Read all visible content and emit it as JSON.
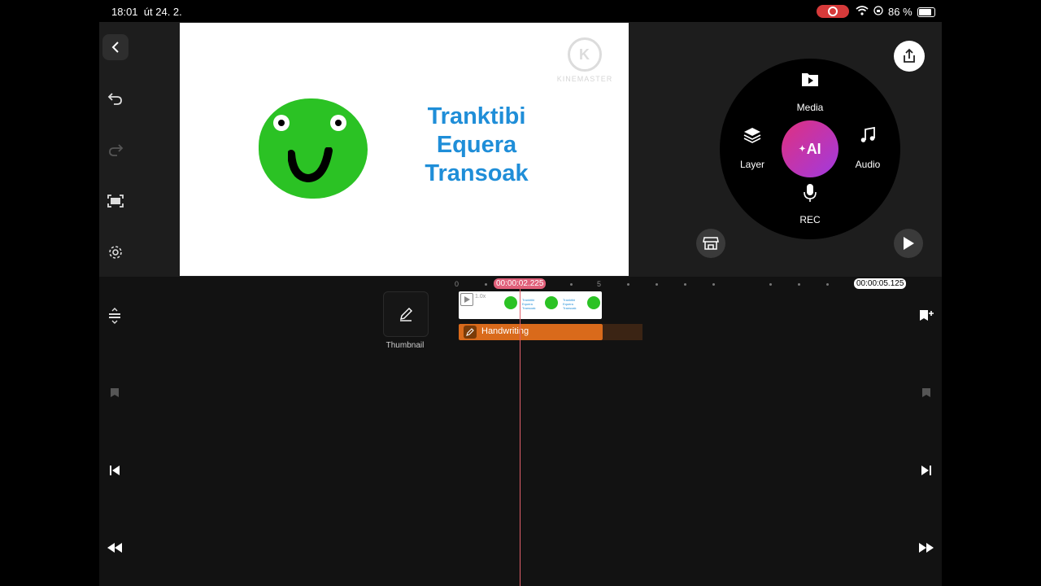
{
  "status_bar": {
    "time": "18:01",
    "date": "út 24. 2.",
    "battery": "86 %"
  },
  "preview": {
    "title_lines": [
      "Tranktibi",
      "Equera",
      "Transoak"
    ],
    "watermark": "KINEMASTER"
  },
  "media_wheel": {
    "media_label": "Media",
    "layer_label": "Layer",
    "audio_label": "Audio",
    "rec_label": "REC",
    "ai_label": "AI"
  },
  "timeline": {
    "current_time": "00:00:02.225",
    "total_time": "00:00:05.125",
    "ruler_marks": [
      "0",
      "5"
    ],
    "thumbnail_label": "Thumbnail",
    "layer_label": "Handwriting",
    "clip_speed": "1.0x",
    "clip_caption": [
      "Tranktibi",
      "Equera",
      "Transoak"
    ]
  },
  "colors": {
    "accent_ai_start": "#e0307f",
    "accent_ai_end": "#a03ae0",
    "layer_bar": "#d96a1b",
    "playhead": "#e0606a",
    "title_blue": "#1f8ed8",
    "frog_green": "#2bc224"
  }
}
